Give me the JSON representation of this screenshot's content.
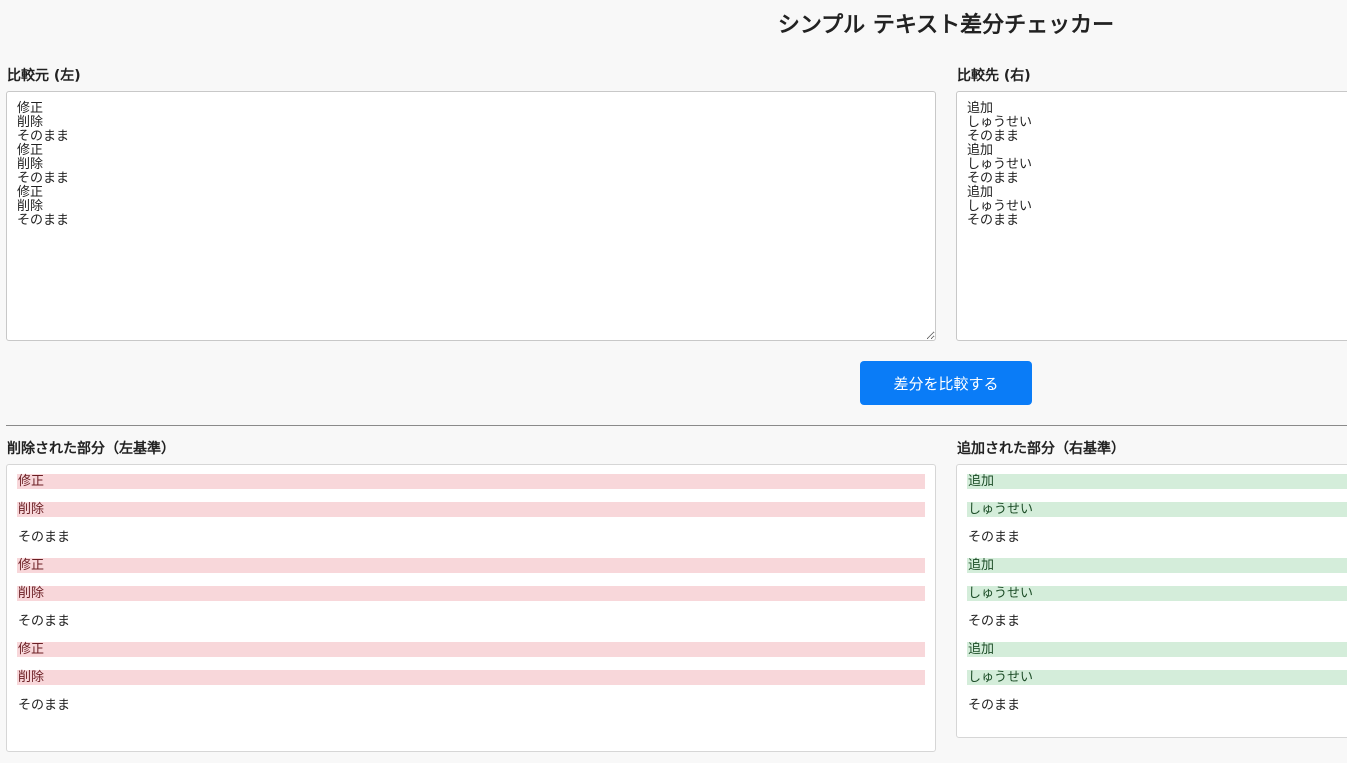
{
  "title": "シンプル テキスト差分チェッカー",
  "left_input": {
    "label": "比較元 (左)",
    "value": "修正\n削除\nそのまま\n修正\n削除\nそのまま\n修正\n削除\nそのまま"
  },
  "right_input": {
    "label": "比較先 (右)",
    "value": "追加\nしゅうせい\nそのまま\n追加\nしゅうせい\nそのまま\n追加\nしゅうせい\nそのまま"
  },
  "compare_button": "差分を比較する",
  "removed": {
    "label": "削除された部分（左基準）",
    "lines": [
      {
        "text": "修正",
        "status": "removed"
      },
      {
        "text": "削除",
        "status": "removed"
      },
      {
        "text": "そのまま",
        "status": "unchanged"
      },
      {
        "text": "修正",
        "status": "removed"
      },
      {
        "text": "削除",
        "status": "removed"
      },
      {
        "text": "そのまま",
        "status": "unchanged"
      },
      {
        "text": "修正",
        "status": "removed"
      },
      {
        "text": "削除",
        "status": "removed"
      },
      {
        "text": "そのまま",
        "status": "unchanged"
      }
    ]
  },
  "added": {
    "label": "追加された部分（右基準）",
    "lines": [
      {
        "text": "追加",
        "status": "added"
      },
      {
        "text": "しゅうせい",
        "status": "added"
      },
      {
        "text": "そのまま",
        "status": "unchanged"
      },
      {
        "text": "追加",
        "status": "added"
      },
      {
        "text": "しゅうせい",
        "status": "added"
      },
      {
        "text": "そのまま",
        "status": "unchanged"
      },
      {
        "text": "追加",
        "status": "added"
      },
      {
        "text": "しゅうせい",
        "status": "added"
      },
      {
        "text": "そのまま",
        "status": "unchanged"
      }
    ]
  },
  "colors": {
    "removed_bg": "#f8d7da",
    "added_bg": "#d4edda",
    "button_bg": "#0a7cf7"
  }
}
